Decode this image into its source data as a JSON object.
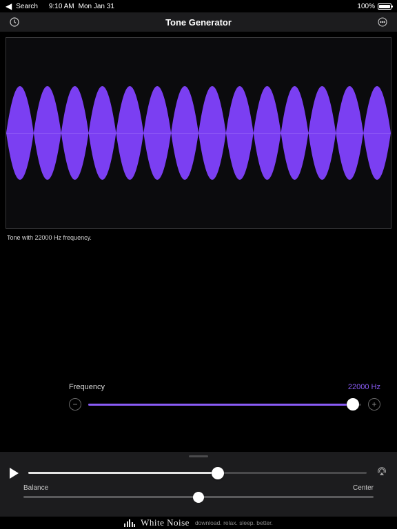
{
  "status": {
    "back_label": "Search",
    "time": "9:10 AM",
    "date": "Mon Jan 31",
    "battery_pct": "100%"
  },
  "header": {
    "title": "Tone Generator",
    "left_icon": "history-icon",
    "right_icon": "more-icon"
  },
  "waveform": {
    "caption": "Tone with 22000 Hz frequency.",
    "color": "#7b3ff2"
  },
  "frequency": {
    "label": "Frequency",
    "value_display": "22000 Hz",
    "value": 22000,
    "min": 20,
    "max": 22000,
    "slider_fill_pct": 97
  },
  "playback": {
    "position_pct": 56
  },
  "balance": {
    "label": "Balance",
    "status": "Center",
    "position_pct": 50
  },
  "footer": {
    "brand": "White Noise",
    "tagline": "download. relax. sleep. better."
  }
}
